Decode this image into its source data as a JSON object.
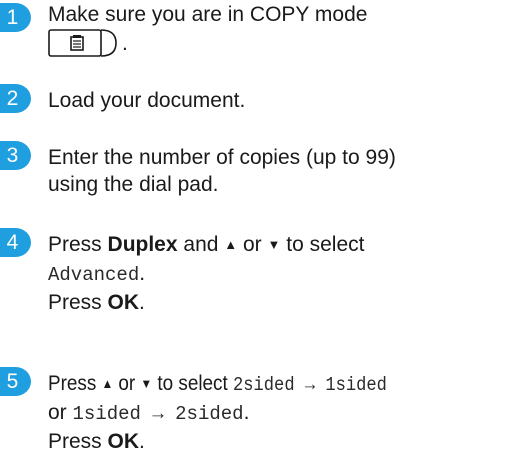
{
  "steps": [
    {
      "number": "1",
      "line1": "Make sure you are in COPY mode",
      "copy_key_icon": "copy-mode-key-icon",
      "line2_suffix": "."
    },
    {
      "number": "2",
      "text": "Load your document."
    },
    {
      "number": "3",
      "line1": "Enter the number of copies (up to 99)",
      "line2": "using the dial pad."
    },
    {
      "number": "4",
      "press": "Press",
      "key": "Duplex",
      "and": "and",
      "up": "▲",
      "or": "or",
      "down": "▼",
      "to_select": "to select",
      "option": "Advanced",
      "period": ".",
      "press2": "Press",
      "ok": "OK",
      "period2": "."
    },
    {
      "number": "5",
      "press": "Press",
      "up": "▲",
      "or": "or",
      "down": "▼",
      "to_select": "to select",
      "option1": "2sided → 1sided",
      "or2": "or",
      "option2": "1sided → 2sided",
      "period": ".",
      "press2": "Press",
      "ok": "OK",
      "period2": "."
    }
  ],
  "colors": {
    "step_badge": "#1f9fe0",
    "text": "#1a1a1a"
  }
}
